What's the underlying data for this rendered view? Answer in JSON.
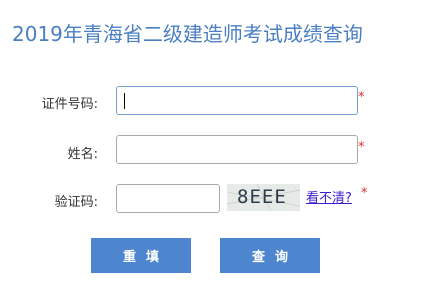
{
  "page_title": "2019年青海省二级建造师考试成绩查询",
  "form": {
    "id_number": {
      "label": "证件号码:",
      "value": "",
      "required_mark": "*"
    },
    "name": {
      "label": "姓名:",
      "value": "",
      "required_mark": "*"
    },
    "captcha": {
      "label": "验证码:",
      "value": "",
      "image_text": "8EEE",
      "refresh_link": "看不清?",
      "required_mark": "*"
    }
  },
  "buttons": {
    "reset_label": "重填",
    "query_label": "查询"
  },
  "colors": {
    "title": "#4a7fc1",
    "button_bg": "#4d86cf",
    "required": "#e03030",
    "link": "#3b1fd0"
  }
}
